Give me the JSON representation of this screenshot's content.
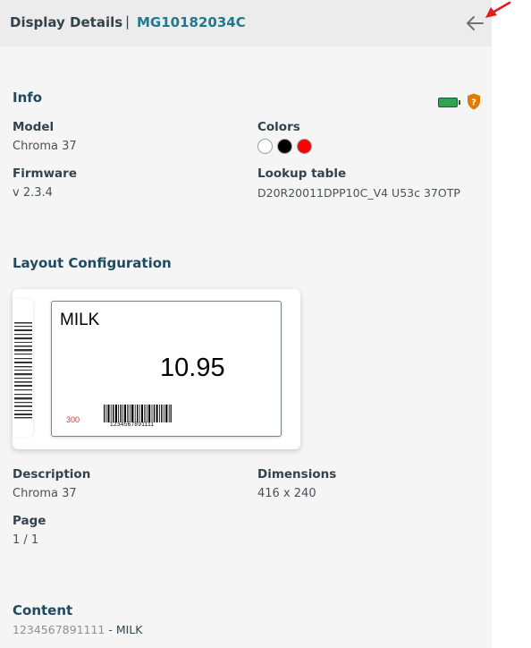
{
  "header": {
    "title": "Display Details",
    "separator": "|",
    "display_id": "MG10182034C"
  },
  "info": {
    "section_title": "Info",
    "battery_color": "#2ea44f",
    "shield_color": "#e07b00",
    "shield_glyph": "?",
    "model_label": "Model",
    "model_value": "Chroma 37",
    "colors_label": "Colors",
    "colors": [
      "#ffffff",
      "#000000",
      "#ff0000"
    ],
    "firmware_label": "Firmware",
    "firmware_value": "v 2.3.4",
    "lookup_label": "Lookup table",
    "lookup_value": "D20R20011DPP10C_V4 U53c 37OTP"
  },
  "layout": {
    "section_title": "Layout Configuration",
    "preview": {
      "product_name": "MILK",
      "price": "10.95",
      "code": "300",
      "barcode_number": "1234567891111"
    },
    "description_label": "Description",
    "description_value": "Chroma 37",
    "dimensions_label": "Dimensions",
    "dimensions_value": "416 x 240",
    "page_label": "Page",
    "page_value": "1 / 1"
  },
  "content": {
    "section_title": "Content",
    "barcode": "1234567891111",
    "separator": " - ",
    "product": "MILK"
  },
  "icons": {
    "back": "arrow-left-icon",
    "battery": "battery-icon",
    "shield": "shield-question-icon",
    "annotation": "red-arrow-annotation"
  }
}
